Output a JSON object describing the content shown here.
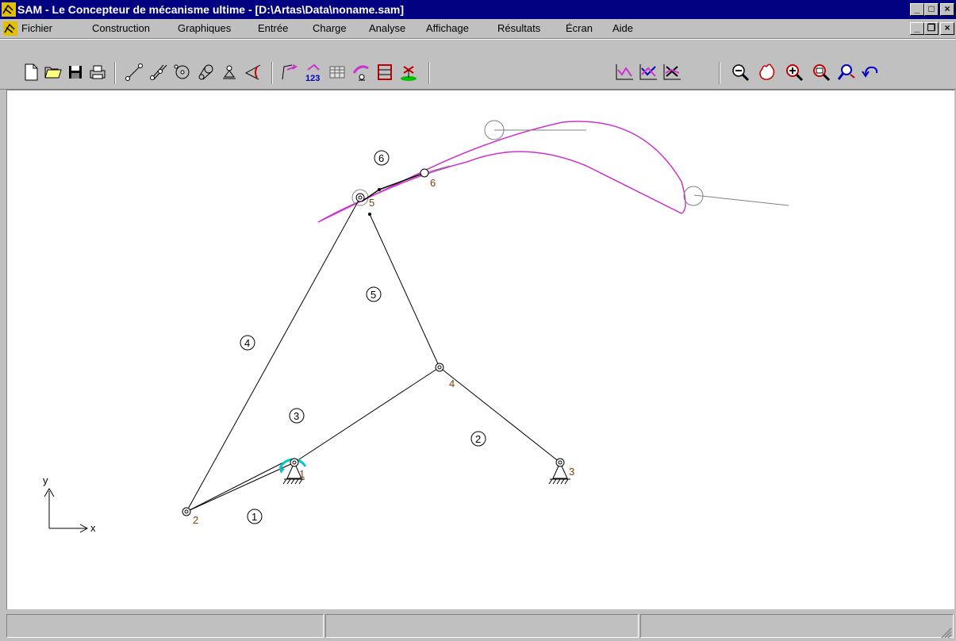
{
  "window": {
    "title": "SAM - Le Concepteur de mécanisme ultime - [D:\\Artas\\Data\\noname.sam]",
    "buttons": [
      "minimize",
      "maximize",
      "close"
    ]
  },
  "menu": {
    "items": [
      "Fichier",
      "Construction",
      "Graphiques",
      "Entrée",
      "Charge",
      "Analyse",
      "Affichage",
      "Résultats",
      "Écran",
      "Aide"
    ]
  },
  "toolbar": {
    "groups": [
      [
        "new-file-icon",
        "open-folder-icon",
        "save-icon",
        "print-icon"
      ],
      [
        "beam-icon",
        "slider-icon",
        "gear-icon",
        "belt-icon",
        "support-icon",
        "angle-icon"
      ],
      [
        "motion-icon",
        "numbering-icon",
        "table-icon",
        "load-icon",
        "frame-icon",
        "motor-icon"
      ],
      [
        "graph-icon",
        "graph-multi-icon",
        "graph-table-icon"
      ],
      [
        "zoom-out-icon",
        "pan-icon",
        "zoom-in-icon",
        "zoom-window-icon",
        "zoom-previous-icon",
        "undo-icon"
      ]
    ]
  },
  "canvas": {
    "node_labels": [
      "1",
      "2",
      "3",
      "4",
      "5",
      "6"
    ],
    "element_labels": [
      "1",
      "2",
      "3",
      "4",
      "5",
      "6"
    ],
    "axes": {
      "x": "x",
      "y": "y"
    },
    "colors": {
      "links": "#000000",
      "node_labels": "#804000",
      "trajectory": "#cc33cc",
      "drive": "#00c8c8",
      "traces": "#808080"
    }
  },
  "statusbar": {
    "panels": [
      "",
      "",
      ""
    ]
  }
}
